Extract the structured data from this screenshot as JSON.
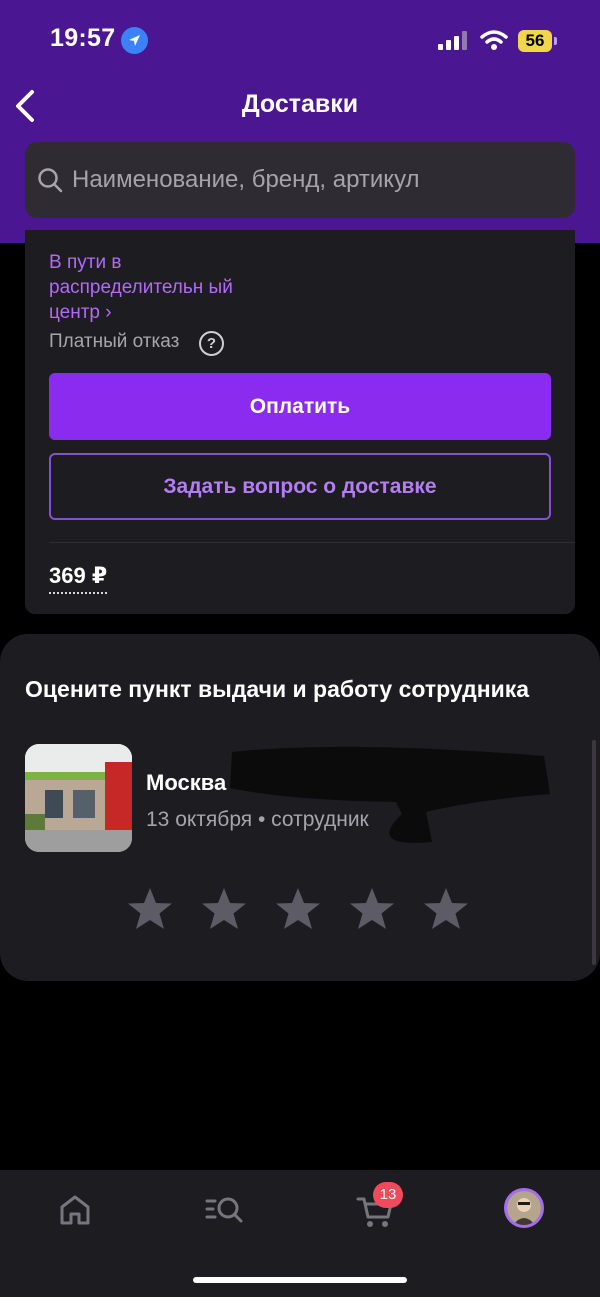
{
  "status_bar": {
    "time": "19:57",
    "battery": "56"
  },
  "header": {
    "title": "Доставки"
  },
  "search": {
    "placeholder": "Наименование, бренд, артикул"
  },
  "delivery": {
    "status_text": "В пути в распределительн ый центр ›",
    "paid_refusal": "Платный отказ",
    "help_symbol": "?",
    "pay_button": "Оплатить",
    "ask_button": "Задать вопрос о доставке",
    "price": "369 ₽"
  },
  "rating": {
    "title": "Оцените пункт выдачи и работу сотрудника",
    "city": "Москва",
    "meta": "13 октября • сотрудник",
    "stars": 5
  },
  "tabbar": {
    "cart_badge": "13"
  },
  "colors": {
    "header_bg": "#4a1691",
    "accent": "#8c2bf0",
    "accent_text": "#b26af7",
    "star": "#5c5b66"
  }
}
